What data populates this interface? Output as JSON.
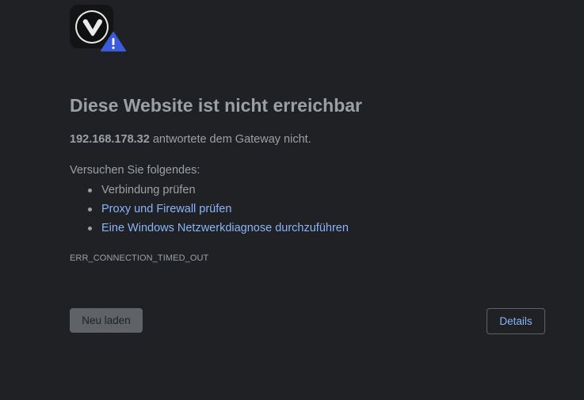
{
  "icons": {
    "logo": "vivaldi-logo-icon",
    "warning": "warning-triangle-icon"
  },
  "colors": {
    "background": "#202124",
    "text": "#9aa0a6",
    "link": "#8ab4f8",
    "warning": "#3b5bdb"
  },
  "error": {
    "title": "Diese Website ist nicht erreichbar",
    "host": "192.168.178.32",
    "summary_rest": " antwortete dem Gateway nicht.",
    "suggestions_heading": "Versuchen Sie folgendes:",
    "suggestions": [
      {
        "label": "Verbindung prüfen"
      },
      {
        "label": "Proxy und Firewall prüfen"
      },
      {
        "label": "Eine Windows Netzwerkdiagnose durchzuführen"
      }
    ],
    "code": "ERR_CONNECTION_TIMED_OUT"
  },
  "buttons": {
    "reload_label": "Neu laden",
    "details_label": "Details"
  }
}
